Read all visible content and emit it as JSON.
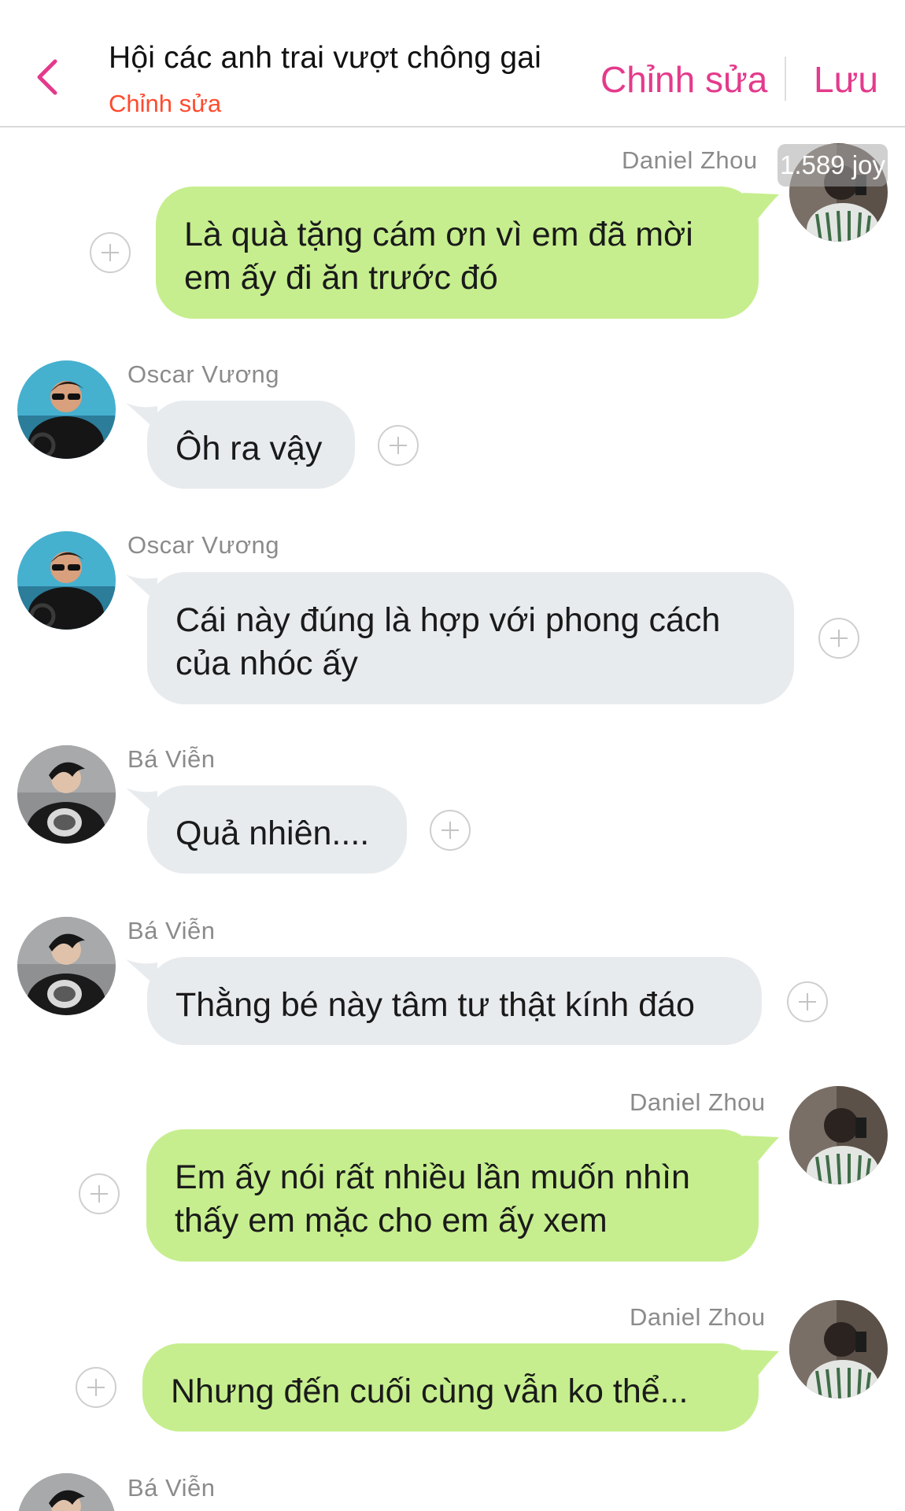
{
  "header": {
    "title": "Hội các anh trai vượt chông gai",
    "subtitle": "Chỉnh sửa",
    "edit_label": "Chỉnh sửa",
    "save_label": "Lưu",
    "back_icon": "chevron-left-icon",
    "accent_color": "#e43a8c",
    "subtitle_color": "#ff4a2e"
  },
  "badge": {
    "text": "1.589 joy"
  },
  "messages": [
    {
      "sender": "Daniel Zhou",
      "text_lines": [
        "Là quà tặng cám ơn vì em đã mời",
        "em ấy đi ăn trước đó"
      ],
      "side": "right",
      "color": "#c6ee8e"
    },
    {
      "sender": "Oscar Vương",
      "text_lines": [
        "Ôh ra vậy"
      ],
      "side": "left",
      "color": "#e8ebee"
    },
    {
      "sender": "Oscar Vương",
      "text_lines": [
        "Cái này đúng là hợp với phong cách",
        "của nhóc ấy"
      ],
      "side": "left",
      "color": "#e8ebee"
    },
    {
      "sender": "Bá Viễn",
      "text_lines": [
        "Quả nhiên...."
      ],
      "side": "left",
      "color": "#e8ebee"
    },
    {
      "sender": "Bá Viễn",
      "text_lines": [
        "Thằng bé này tâm tư thật kính đáo"
      ],
      "side": "left",
      "color": "#e8ebee"
    },
    {
      "sender": "Daniel Zhou",
      "text_lines": [
        "Em ấy nói rất nhiều lần muốn nhìn",
        "thấy em mặc cho em ấy xem"
      ],
      "side": "right",
      "color": "#c6ee8e"
    },
    {
      "sender": "Daniel Zhou",
      "text_lines": [
        "Nhưng đến cuối cùng vẫn ko thể..."
      ],
      "side": "right",
      "color": "#c6ee8e"
    },
    {
      "sender": "Bá Viễn",
      "text_lines": [],
      "side": "left",
      "color": "#e8ebee"
    }
  ],
  "icons": {
    "add_reaction": "plus-circle-icon"
  }
}
